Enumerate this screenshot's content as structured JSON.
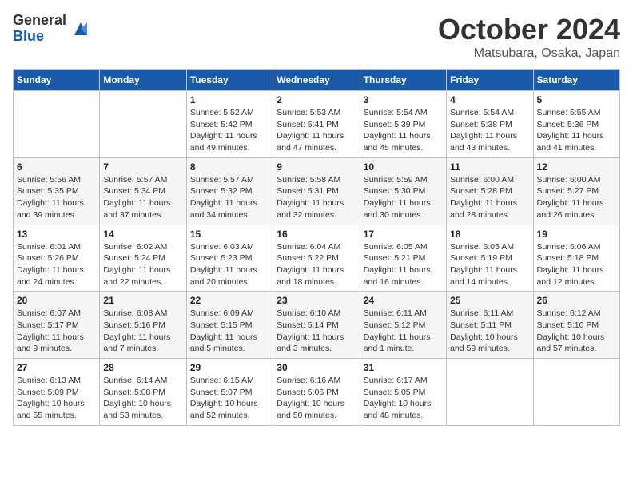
{
  "logo": {
    "general": "General",
    "blue": "Blue"
  },
  "header": {
    "month": "October 2024",
    "location": "Matsubara, Osaka, Japan"
  },
  "weekdays": [
    "Sunday",
    "Monday",
    "Tuesday",
    "Wednesday",
    "Thursday",
    "Friday",
    "Saturday"
  ],
  "weeks": [
    [
      {
        "day": "",
        "sunrise": "",
        "sunset": "",
        "daylight": ""
      },
      {
        "day": "",
        "sunrise": "",
        "sunset": "",
        "daylight": ""
      },
      {
        "day": "1",
        "sunrise": "Sunrise: 5:52 AM",
        "sunset": "Sunset: 5:42 PM",
        "daylight": "Daylight: 11 hours and 49 minutes."
      },
      {
        "day": "2",
        "sunrise": "Sunrise: 5:53 AM",
        "sunset": "Sunset: 5:41 PM",
        "daylight": "Daylight: 11 hours and 47 minutes."
      },
      {
        "day": "3",
        "sunrise": "Sunrise: 5:54 AM",
        "sunset": "Sunset: 5:39 PM",
        "daylight": "Daylight: 11 hours and 45 minutes."
      },
      {
        "day": "4",
        "sunrise": "Sunrise: 5:54 AM",
        "sunset": "Sunset: 5:38 PM",
        "daylight": "Daylight: 11 hours and 43 minutes."
      },
      {
        "day": "5",
        "sunrise": "Sunrise: 5:55 AM",
        "sunset": "Sunset: 5:36 PM",
        "daylight": "Daylight: 11 hours and 41 minutes."
      }
    ],
    [
      {
        "day": "6",
        "sunrise": "Sunrise: 5:56 AM",
        "sunset": "Sunset: 5:35 PM",
        "daylight": "Daylight: 11 hours and 39 minutes."
      },
      {
        "day": "7",
        "sunrise": "Sunrise: 5:57 AM",
        "sunset": "Sunset: 5:34 PM",
        "daylight": "Daylight: 11 hours and 37 minutes."
      },
      {
        "day": "8",
        "sunrise": "Sunrise: 5:57 AM",
        "sunset": "Sunset: 5:32 PM",
        "daylight": "Daylight: 11 hours and 34 minutes."
      },
      {
        "day": "9",
        "sunrise": "Sunrise: 5:58 AM",
        "sunset": "Sunset: 5:31 PM",
        "daylight": "Daylight: 11 hours and 32 minutes."
      },
      {
        "day": "10",
        "sunrise": "Sunrise: 5:59 AM",
        "sunset": "Sunset: 5:30 PM",
        "daylight": "Daylight: 11 hours and 30 minutes."
      },
      {
        "day": "11",
        "sunrise": "Sunrise: 6:00 AM",
        "sunset": "Sunset: 5:28 PM",
        "daylight": "Daylight: 11 hours and 28 minutes."
      },
      {
        "day": "12",
        "sunrise": "Sunrise: 6:00 AM",
        "sunset": "Sunset: 5:27 PM",
        "daylight": "Daylight: 11 hours and 26 minutes."
      }
    ],
    [
      {
        "day": "13",
        "sunrise": "Sunrise: 6:01 AM",
        "sunset": "Sunset: 5:26 PM",
        "daylight": "Daylight: 11 hours and 24 minutes."
      },
      {
        "day": "14",
        "sunrise": "Sunrise: 6:02 AM",
        "sunset": "Sunset: 5:24 PM",
        "daylight": "Daylight: 11 hours and 22 minutes."
      },
      {
        "day": "15",
        "sunrise": "Sunrise: 6:03 AM",
        "sunset": "Sunset: 5:23 PM",
        "daylight": "Daylight: 11 hours and 20 minutes."
      },
      {
        "day": "16",
        "sunrise": "Sunrise: 6:04 AM",
        "sunset": "Sunset: 5:22 PM",
        "daylight": "Daylight: 11 hours and 18 minutes."
      },
      {
        "day": "17",
        "sunrise": "Sunrise: 6:05 AM",
        "sunset": "Sunset: 5:21 PM",
        "daylight": "Daylight: 11 hours and 16 minutes."
      },
      {
        "day": "18",
        "sunrise": "Sunrise: 6:05 AM",
        "sunset": "Sunset: 5:19 PM",
        "daylight": "Daylight: 11 hours and 14 minutes."
      },
      {
        "day": "19",
        "sunrise": "Sunrise: 6:06 AM",
        "sunset": "Sunset: 5:18 PM",
        "daylight": "Daylight: 11 hours and 12 minutes."
      }
    ],
    [
      {
        "day": "20",
        "sunrise": "Sunrise: 6:07 AM",
        "sunset": "Sunset: 5:17 PM",
        "daylight": "Daylight: 11 hours and 9 minutes."
      },
      {
        "day": "21",
        "sunrise": "Sunrise: 6:08 AM",
        "sunset": "Sunset: 5:16 PM",
        "daylight": "Daylight: 11 hours and 7 minutes."
      },
      {
        "day": "22",
        "sunrise": "Sunrise: 6:09 AM",
        "sunset": "Sunset: 5:15 PM",
        "daylight": "Daylight: 11 hours and 5 minutes."
      },
      {
        "day": "23",
        "sunrise": "Sunrise: 6:10 AM",
        "sunset": "Sunset: 5:14 PM",
        "daylight": "Daylight: 11 hours and 3 minutes."
      },
      {
        "day": "24",
        "sunrise": "Sunrise: 6:11 AM",
        "sunset": "Sunset: 5:12 PM",
        "daylight": "Daylight: 11 hours and 1 minute."
      },
      {
        "day": "25",
        "sunrise": "Sunrise: 6:11 AM",
        "sunset": "Sunset: 5:11 PM",
        "daylight": "Daylight: 10 hours and 59 minutes."
      },
      {
        "day": "26",
        "sunrise": "Sunrise: 6:12 AM",
        "sunset": "Sunset: 5:10 PM",
        "daylight": "Daylight: 10 hours and 57 minutes."
      }
    ],
    [
      {
        "day": "27",
        "sunrise": "Sunrise: 6:13 AM",
        "sunset": "Sunset: 5:09 PM",
        "daylight": "Daylight: 10 hours and 55 minutes."
      },
      {
        "day": "28",
        "sunrise": "Sunrise: 6:14 AM",
        "sunset": "Sunset: 5:08 PM",
        "daylight": "Daylight: 10 hours and 53 minutes."
      },
      {
        "day": "29",
        "sunrise": "Sunrise: 6:15 AM",
        "sunset": "Sunset: 5:07 PM",
        "daylight": "Daylight: 10 hours and 52 minutes."
      },
      {
        "day": "30",
        "sunrise": "Sunrise: 6:16 AM",
        "sunset": "Sunset: 5:06 PM",
        "daylight": "Daylight: 10 hours and 50 minutes."
      },
      {
        "day": "31",
        "sunrise": "Sunrise: 6:17 AM",
        "sunset": "Sunset: 5:05 PM",
        "daylight": "Daylight: 10 hours and 48 minutes."
      },
      {
        "day": "",
        "sunrise": "",
        "sunset": "",
        "daylight": ""
      },
      {
        "day": "",
        "sunrise": "",
        "sunset": "",
        "daylight": ""
      }
    ]
  ]
}
